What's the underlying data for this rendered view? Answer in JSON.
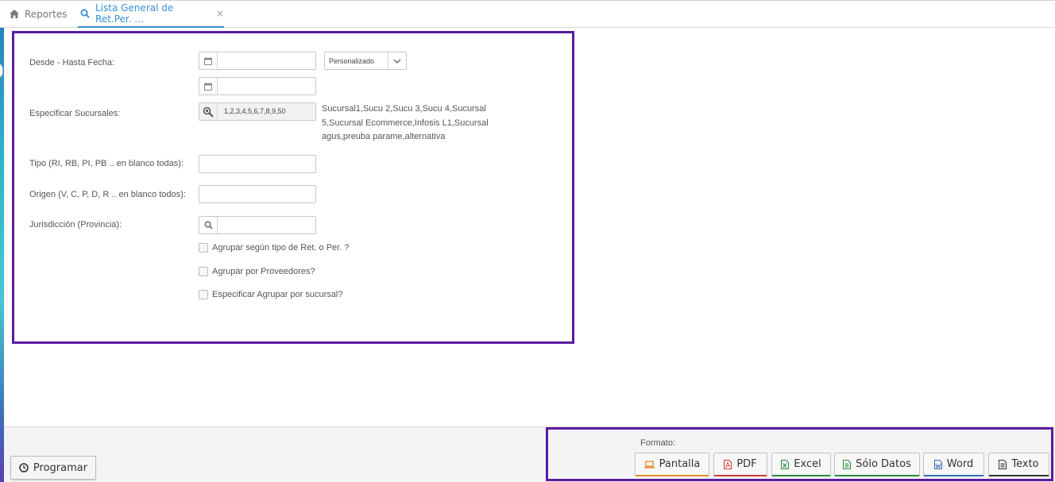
{
  "tabs": [
    {
      "label": "Reportes",
      "icon": "home-icon"
    },
    {
      "label": "Lista General de Ret.Per. ...",
      "icon": "search-icon",
      "active": true
    }
  ],
  "form": {
    "fecha_label": "Desde - Hasta Fecha:",
    "fecha_desde_value": "",
    "fecha_hasta_value": "",
    "periodo_select": "Personalizado",
    "sucursales_label": "Especificar Sucursales:",
    "sucursales_value": "1,2,3,4,5,6,7,8,9,50",
    "sucursales_names": "Sucursal1,Sucu 2,Sucu 3,Sucu 4,Sucursal 5,Sucursal Ecommerce,Infosis L1,Sucursal agus,preuba parame,alternativa",
    "tipo_label": "Tipo (RI, RB, PI, PB .. en blanco todas):",
    "tipo_value": "",
    "origen_label": "Origen (V, C, P, D, R .. en blanco todos):",
    "origen_value": "",
    "jurisdiccion_label": "Jurisdicción (Provincia):",
    "jurisdiccion_value": "",
    "check_agrupar_tipo": "Agrupar según tipo de Ret. o Per. ?",
    "check_agrupar_proveedores": "Agrupar por Proveedores?",
    "check_agrupar_sucursal": "Especificar Agrupar por sucursal?"
  },
  "footer": {
    "programar_label": "Programar",
    "formato_label": "Formato:",
    "buttons": [
      {
        "label": "Pantalla",
        "icon": "laptop-icon",
        "color": "#e38b2c"
      },
      {
        "label": "PDF",
        "icon": "pdf-file-icon",
        "color": "#d03a2f"
      },
      {
        "label": "Excel",
        "icon": "excel-file-icon",
        "color": "#2e8b3c"
      },
      {
        "label": "Sólo Datos",
        "icon": "data-file-icon",
        "color": "#2e8b3c"
      },
      {
        "label": "Word",
        "icon": "word-file-icon",
        "color": "#3a6bb5"
      },
      {
        "label": "Texto",
        "icon": "text-file-icon",
        "color": "#333333"
      }
    ]
  },
  "colors": {
    "accent": "#3a8fd6",
    "highlight_border": "#5b1b9e"
  }
}
